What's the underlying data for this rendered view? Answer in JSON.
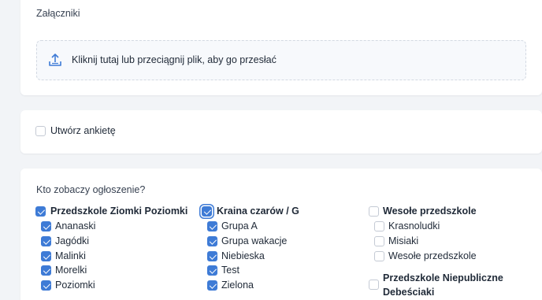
{
  "attachments": {
    "title": "Załączniki",
    "dropzone_text": "Kliknij tutaj lub przeciągnij plik, aby go przesłać"
  },
  "survey": {
    "label": "Utwórz ankietę",
    "checked": false
  },
  "audience": {
    "title": "Kto zobaczy ogłoszenie?",
    "columns": [
      {
        "label": "Przedszkole Ziomki Poziomki",
        "checked": true,
        "items": [
          {
            "label": "Ananaski",
            "checked": true
          },
          {
            "label": "Jagódki",
            "checked": true
          },
          {
            "label": "Malinki",
            "checked": true
          },
          {
            "label": "Morelki",
            "checked": true
          },
          {
            "label": "Poziomki",
            "checked": true
          }
        ]
      },
      {
        "label": "Kraina czarów / G",
        "checked": true,
        "items": [
          {
            "label": "Grupa A",
            "checked": true
          },
          {
            "label": "Grupa wakacje",
            "checked": true
          },
          {
            "label": "Niebieska",
            "checked": true
          },
          {
            "label": "Test",
            "checked": true
          },
          {
            "label": "Zielona",
            "checked": true
          }
        ]
      },
      {
        "label": "Wesołe przedszkole",
        "checked": false,
        "items": [
          {
            "label": "Krasnoludki",
            "checked": false
          },
          {
            "label": "Misiaki",
            "checked": false
          },
          {
            "label": "Wesołe przedszkole",
            "checked": false
          }
        ]
      }
    ],
    "extra_group": {
      "label_line1": "Przedszkole Niepubliczne",
      "label_line2": "Debeściaki",
      "checked": false
    }
  },
  "colors": {
    "accent": "#3e7bd6",
    "background": "#f2f4f7",
    "card": "#ffffff"
  },
  "icons": {
    "dropzone": "upload-icon"
  }
}
